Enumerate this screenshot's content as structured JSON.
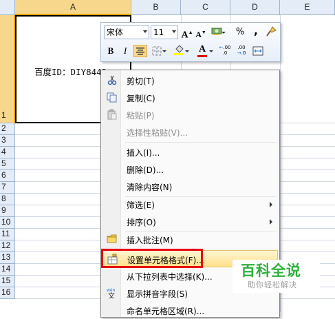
{
  "columns": [
    "A",
    "B",
    "C",
    "D",
    "E"
  ],
  "rows": [
    "1",
    "2",
    "3",
    "4",
    "5",
    "6",
    "7",
    "8",
    "9",
    "10",
    "11",
    "12",
    "13",
    "14",
    "15",
    "16"
  ],
  "cell_a1_text": "百度ID：DIY8442",
  "mini_toolbar": {
    "font_name": "宋体",
    "font_size": "11",
    "bold_label": "B",
    "italic_label": "I",
    "grow_font_label": "A",
    "shrink_font_label": "A",
    "percent_label": "%",
    "comma_label": ",",
    "font_color_label": "A",
    "increase_decimal_label": ".00",
    "decrease_decimal_label": ".00",
    "colors": {
      "fill_highlight": "#ffff00",
      "font_red": "#e00000"
    }
  },
  "context_menu": {
    "items": [
      {
        "label": "剪切(T)",
        "disabled": false,
        "icon": "scissors-icon"
      },
      {
        "label": "复制(C)",
        "disabled": false,
        "icon": "copy-icon"
      },
      {
        "label": "粘贴(P)",
        "disabled": true,
        "icon": "paste-icon"
      },
      {
        "label": "选择性粘贴(V)...",
        "disabled": true
      },
      {
        "label": "插入(I)...",
        "disabled": false
      },
      {
        "label": "删除(D)...",
        "disabled": false
      },
      {
        "label": "清除内容(N)",
        "disabled": false
      },
      {
        "label": "筛选(E)",
        "disabled": false,
        "submenu": true
      },
      {
        "label": "排序(O)",
        "disabled": false,
        "submenu": true
      },
      {
        "label": "插入批注(M)",
        "disabled": false,
        "icon": "comment-icon"
      },
      {
        "label": "设置单元格格式(F)...",
        "disabled": false,
        "icon": "format-cells-icon",
        "highlighted": true
      },
      {
        "label": "从下拉列表中选择(K)...",
        "disabled": false
      },
      {
        "label": "显示拼音字段(S)",
        "disabled": false,
        "icon": "phonetic-icon"
      },
      {
        "label": "命名单元格区域(R)...",
        "disabled": false
      }
    ]
  },
  "watermark": {
    "title": "百科全说",
    "subtitle": "助你轻松解决"
  }
}
